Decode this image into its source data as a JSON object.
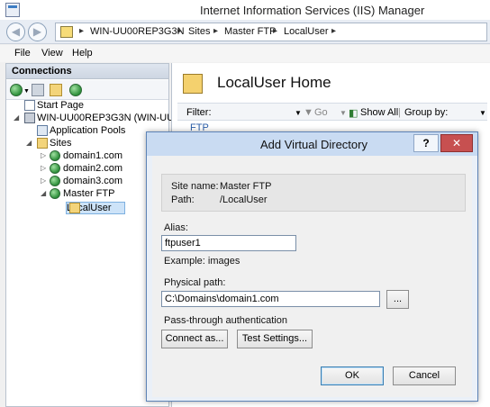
{
  "window": {
    "title": "Internet Information Services (IIS) Manager"
  },
  "address": {
    "crumbs": [
      "WIN-UU00REP3G3N",
      "Sites",
      "Master FTP",
      "LocalUser"
    ],
    "separator": "▸"
  },
  "menu": [
    "File",
    "View",
    "Help"
  ],
  "connections": {
    "header": "Connections",
    "tree": {
      "start_page": "Start Page",
      "server": "WIN-UU00REP3G3N (WIN-UU00RE",
      "app_pools": "Application Pools",
      "sites": "Sites",
      "domain1": "domain1.com",
      "domain2": "domain2.com",
      "domain3": "domain3.com",
      "master_ftp": "Master FTP",
      "local_user": "LocalUser"
    }
  },
  "main": {
    "title": "LocalUser Home",
    "filter_label": "Filter:",
    "go_label": "Go",
    "show_all_label": "Show All",
    "group_by_label": "Group by:",
    "ftp_label": "FTP"
  },
  "dialog": {
    "title": "Add Virtual Directory",
    "help_glyph": "?",
    "close_glyph": "✕",
    "site_name_label": "Site name:",
    "site_name_value": "Master FTP",
    "path_label": "Path:",
    "path_value": "/LocalUser",
    "alias_label": "Alias:",
    "alias_value": "ftpuser1",
    "example_text": "Example: images",
    "physical_path_label": "Physical path:",
    "physical_path_value": "C:\\Domains\\domain1.com",
    "browse_label": "...",
    "pass_through_label": "Pass-through authentication",
    "connect_as_label": "Connect as...",
    "test_settings_label": "Test Settings...",
    "ok_label": "OK",
    "cancel_label": "Cancel"
  }
}
